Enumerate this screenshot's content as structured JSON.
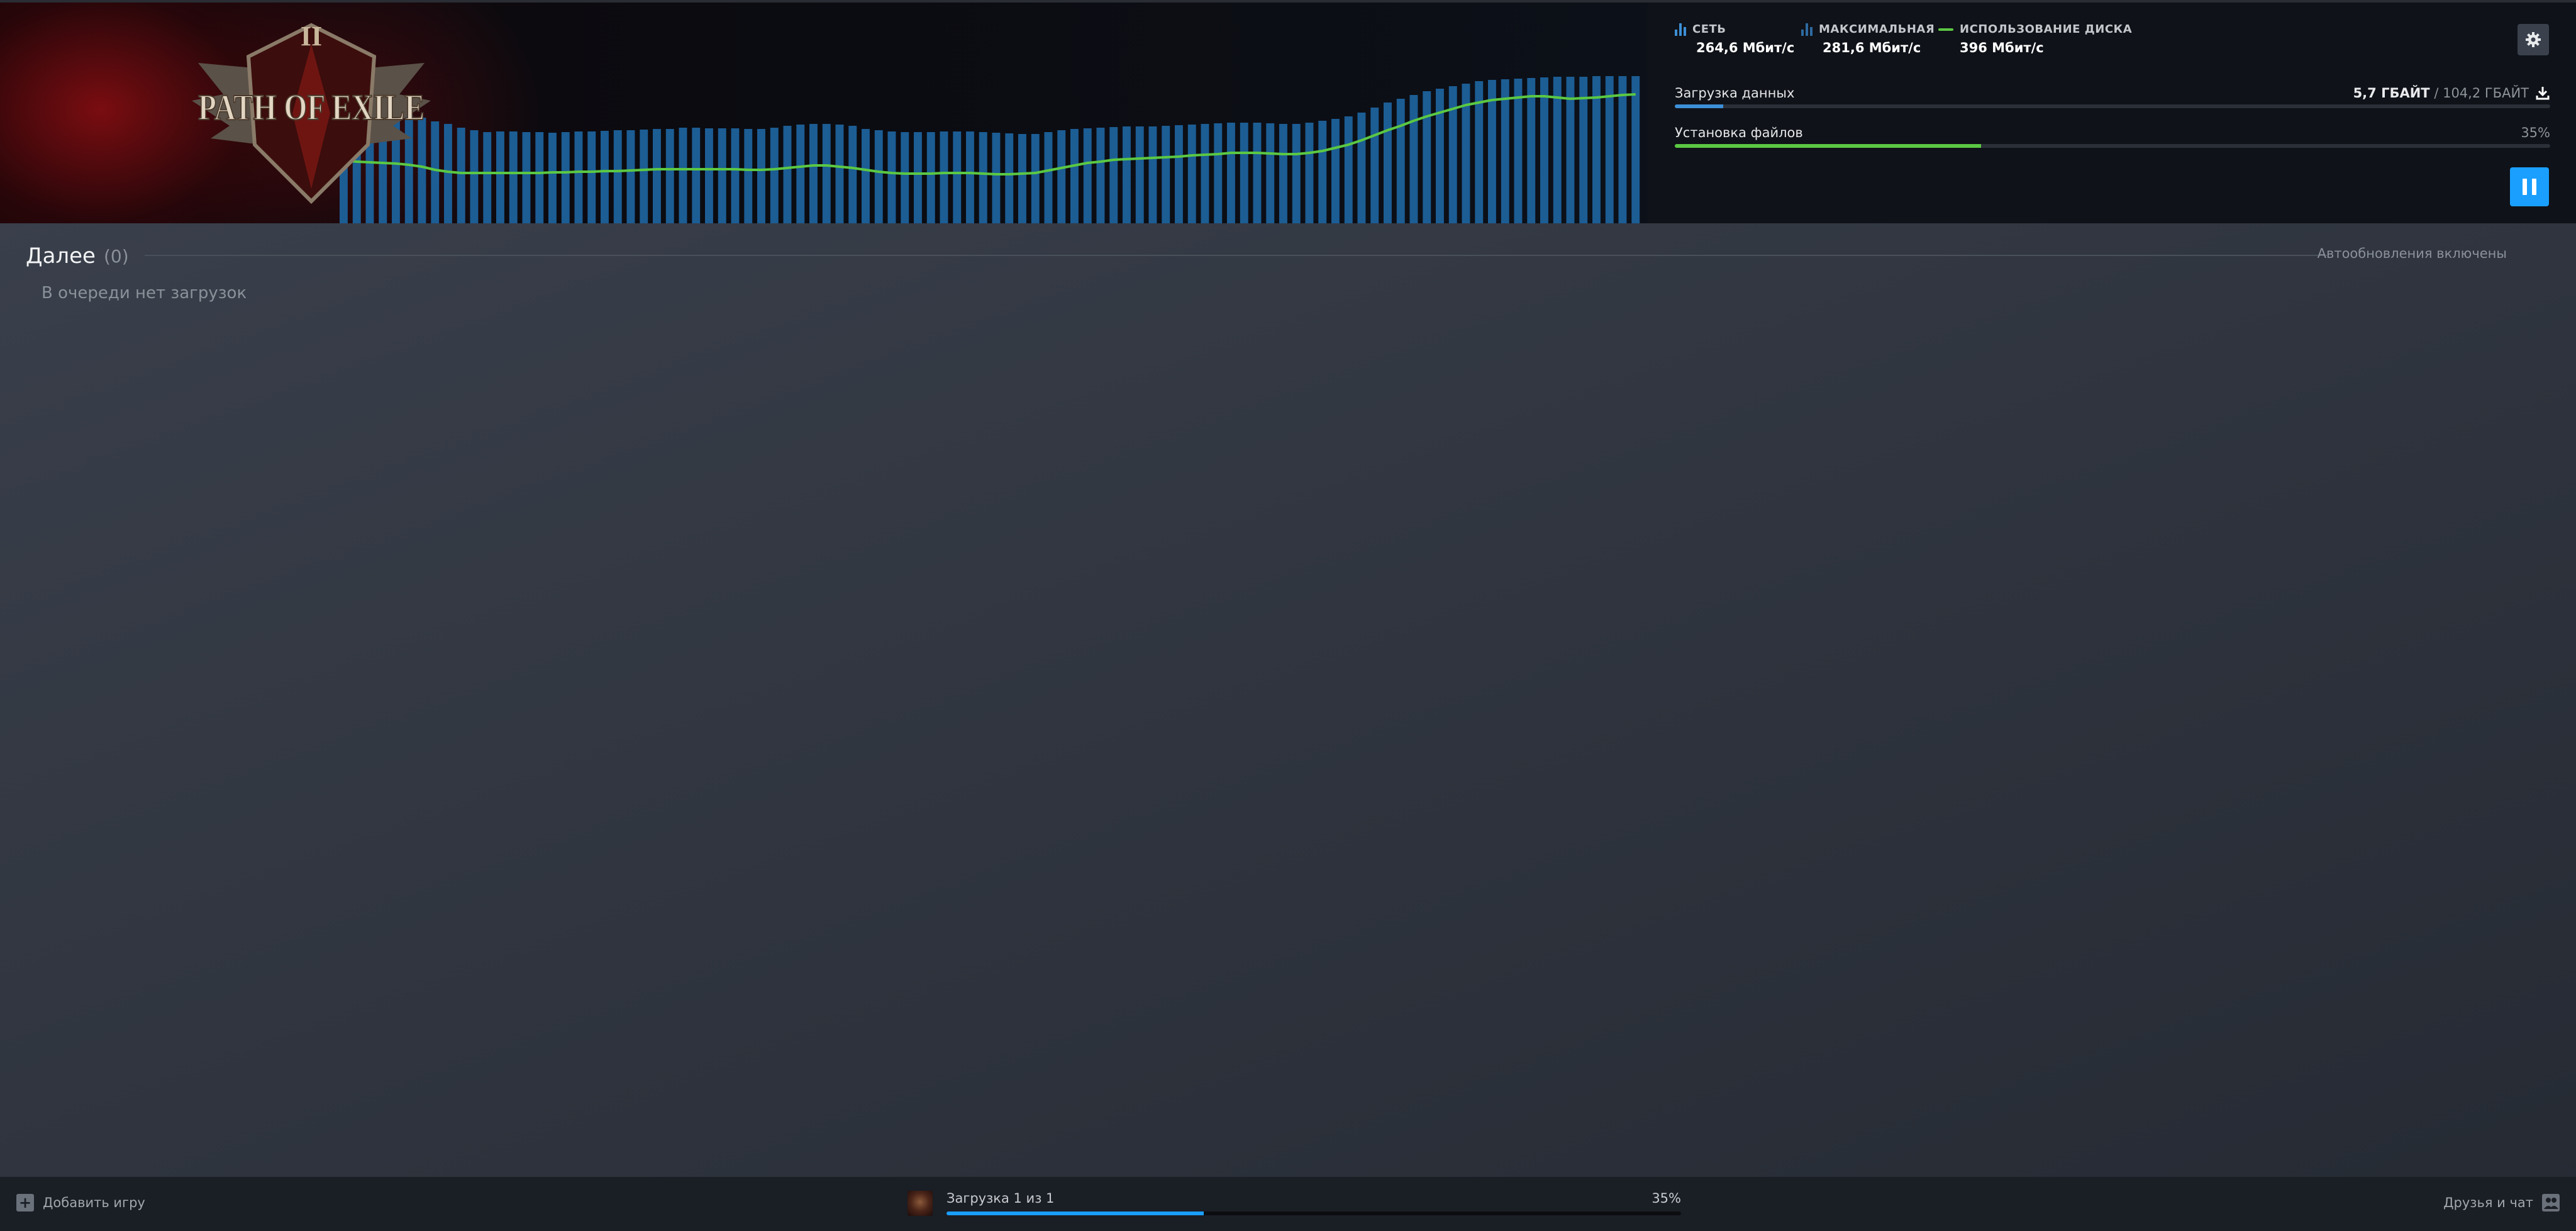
{
  "colors": {
    "accent": "#1a9fff",
    "network_bar": "#1c5d94",
    "disk_line": "#5bc843",
    "install_fill": "#5bc843",
    "download_fill": "#3d8fd6"
  },
  "hero": {
    "game_logo_text": "PATH OF EXILE",
    "logo_numeral": "II"
  },
  "stats": {
    "network": {
      "label": "СЕТЬ",
      "value": "264,6 Мбит/с",
      "icon": "bar-chart-icon"
    },
    "peak": {
      "label": "МАКСИМАЛЬНАЯ",
      "value": "281,6 Мбит/с",
      "icon": "bar-chart-icon"
    },
    "disk": {
      "label": "ИСПОЛЬЗОВАНИЕ ДИСКА",
      "value": "396 Мбит/с",
      "icon": "line-icon"
    }
  },
  "progress": {
    "download": {
      "label": "Загрузка данных",
      "current": "5,7 ГБАЙТ",
      "sep": "/",
      "total": "104,2 ГБАЙТ",
      "fraction": 0.055,
      "icon": "download-icon"
    },
    "install": {
      "label": "Установка файлов",
      "percent_text": "35%",
      "fraction": 0.35
    }
  },
  "controls": {
    "gear_icon": "gear-icon",
    "pause_icon": "pause-icon"
  },
  "queue": {
    "title": "Далее",
    "count": "(0)",
    "auto_updates": "Автообновления включены",
    "empty_text": "В очереди нет загрузок"
  },
  "footer": {
    "add_game": "Добавить игру",
    "download_status": "Загрузка 1 из 1",
    "download_percent": "35%",
    "download_fraction": 0.35,
    "friends": "Друзья и чат"
  },
  "chart_data": {
    "type": "bar",
    "title": "",
    "xlabel": "",
    "ylabel": "",
    "ylim": [
      0,
      300
    ],
    "grid": false,
    "legend": "top",
    "series": [
      {
        "name": "СЕТЬ",
        "type": "bar",
        "values": [
          180,
          180,
          178,
          176,
          175,
          172,
          168,
          162,
          158,
          152,
          148,
          145,
          146,
          146,
          145,
          145,
          144,
          145,
          146,
          146,
          147,
          148,
          148,
          149,
          150,
          150,
          152,
          152,
          151,
          151,
          151,
          150,
          150,
          152,
          155,
          157,
          158,
          158,
          157,
          155,
          150,
          148,
          146,
          145,
          145,
          145,
          146,
          146,
          146,
          145,
          144,
          143,
          142,
          142,
          145,
          148,
          150,
          151,
          152,
          153,
          154,
          154,
          154,
          155,
          156,
          157,
          158,
          159,
          160,
          160,
          160,
          159,
          158,
          158,
          160,
          163,
          166,
          170,
          176,
          184,
          192,
          198,
          204,
          210,
          214,
          218,
          222,
          226,
          228,
          229,
          230,
          231,
          232,
          233,
          233,
          233,
          234,
          234,
          234,
          234
        ]
      },
      {
        "name": "ИСПОЛЬЗОВАНИЕ ДИСКА",
        "type": "line",
        "values": [
          100,
          98,
          97,
          96,
          95,
          93,
          90,
          85,
          82,
          80,
          80,
          80,
          80,
          80,
          80,
          80,
          81,
          81,
          82,
          82,
          83,
          83,
          84,
          85,
          86,
          86,
          86,
          86,
          86,
          86,
          86,
          85,
          85,
          86,
          88,
          90,
          92,
          92,
          90,
          88,
          85,
          82,
          80,
          79,
          79,
          79,
          80,
          80,
          80,
          79,
          78,
          78,
          79,
          80,
          84,
          88,
          92,
          96,
          98,
          101,
          102,
          103,
          104,
          105,
          106,
          108,
          109,
          110,
          112,
          112,
          112,
          111,
          110,
          110,
          112,
          115,
          120,
          125,
          132,
          140,
          148,
          155,
          163,
          170,
          176,
          182,
          188,
          192,
          196,
          198,
          200,
          202,
          202,
          200,
          198,
          199,
          200,
          202,
          204,
          205
        ]
      }
    ]
  }
}
